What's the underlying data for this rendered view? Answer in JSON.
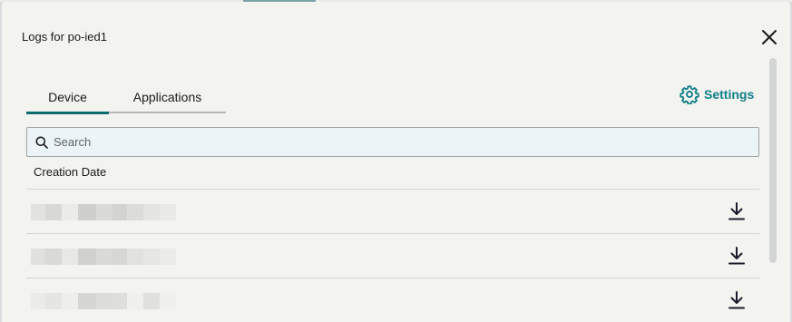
{
  "dialog": {
    "title": "Logs for po-ied1"
  },
  "tabs": [
    {
      "label": "Device",
      "active": true
    },
    {
      "label": "Applications",
      "active": false
    }
  ],
  "settings": {
    "label": "Settings",
    "icon": "gear-icon"
  },
  "search": {
    "placeholder": "Search",
    "value": ""
  },
  "table": {
    "column_header": "Creation Date",
    "rows": [
      {
        "creation_date": "",
        "action_icon": "download-icon"
      },
      {
        "creation_date": "",
        "action_icon": "download-icon"
      },
      {
        "creation_date": "",
        "action_icon": "download-icon"
      }
    ]
  },
  "colors": {
    "accent": "#0e7f87",
    "tab_active": "#0a6b6e",
    "background": "#f3f3f0",
    "search_bg": "#ebf4f6"
  }
}
